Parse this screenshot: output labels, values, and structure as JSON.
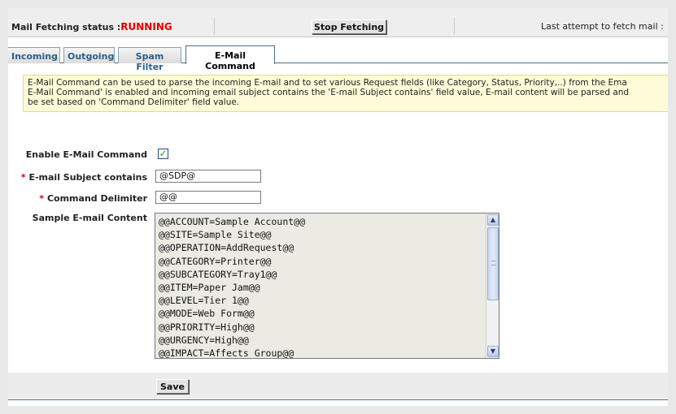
{
  "status": {
    "label": "Mail Fetching status :",
    "value": "RUNNING",
    "stop_button": "Stop Fetching",
    "last_attempt": "Last attempt to fetch mail :"
  },
  "tabs": [
    {
      "label": "Incoming",
      "active": false
    },
    {
      "label": "Outgoing",
      "active": false
    },
    {
      "label": "Spam Filter",
      "active": false
    },
    {
      "label": "E-Mail Command",
      "active": true
    }
  ],
  "info": {
    "line1": "E-Mail Command can be used to parse the incoming E-mail and to set various Request fields (like Category, Status, Priority,..) from the Ema",
    "line2": "E-Mail Command' is enabled and incoming email subject contains the 'E-mail Subject contains' field value, E-mail content will be parsed and",
    "line3": "be set based on 'Command Delimiter' field value."
  },
  "form": {
    "enable_label": "Enable E-Mail Command",
    "enable_checked": true,
    "required_mark": "*",
    "subject_label": "E-mail Subject contains",
    "subject_value": "@SDP@",
    "delimiter_label": "Command Delimiter",
    "delimiter_value": "@@",
    "sample_label": "Sample E-mail Content",
    "sample_lines": [
      "@@ACCOUNT=Sample Account@@",
      "@@SITE=Sample Site@@",
      "@@OPERATION=AddRequest@@",
      "@@CATEGORY=Printer@@",
      "@@SUBCATEGORY=Tray1@@",
      "@@ITEM=Paper Jam@@",
      "@@LEVEL=Tier 1@@",
      "@@MODE=Web Form@@",
      "@@PRIORITY=High@@",
      "@@URGENCY=High@@",
      "@@IMPACT=Affects Group@@"
    ]
  },
  "footer": {
    "save_label": "Save"
  },
  "icons": {
    "check": "check-icon",
    "scroll_up": "chevron-up-icon",
    "scroll_down": "chevron-down-icon"
  },
  "colors": {
    "running": "#e00000",
    "required": "#e00000",
    "tab_text": "#2b5f8a",
    "info_bg": "#fdfbd8",
    "check": "#28a028"
  }
}
